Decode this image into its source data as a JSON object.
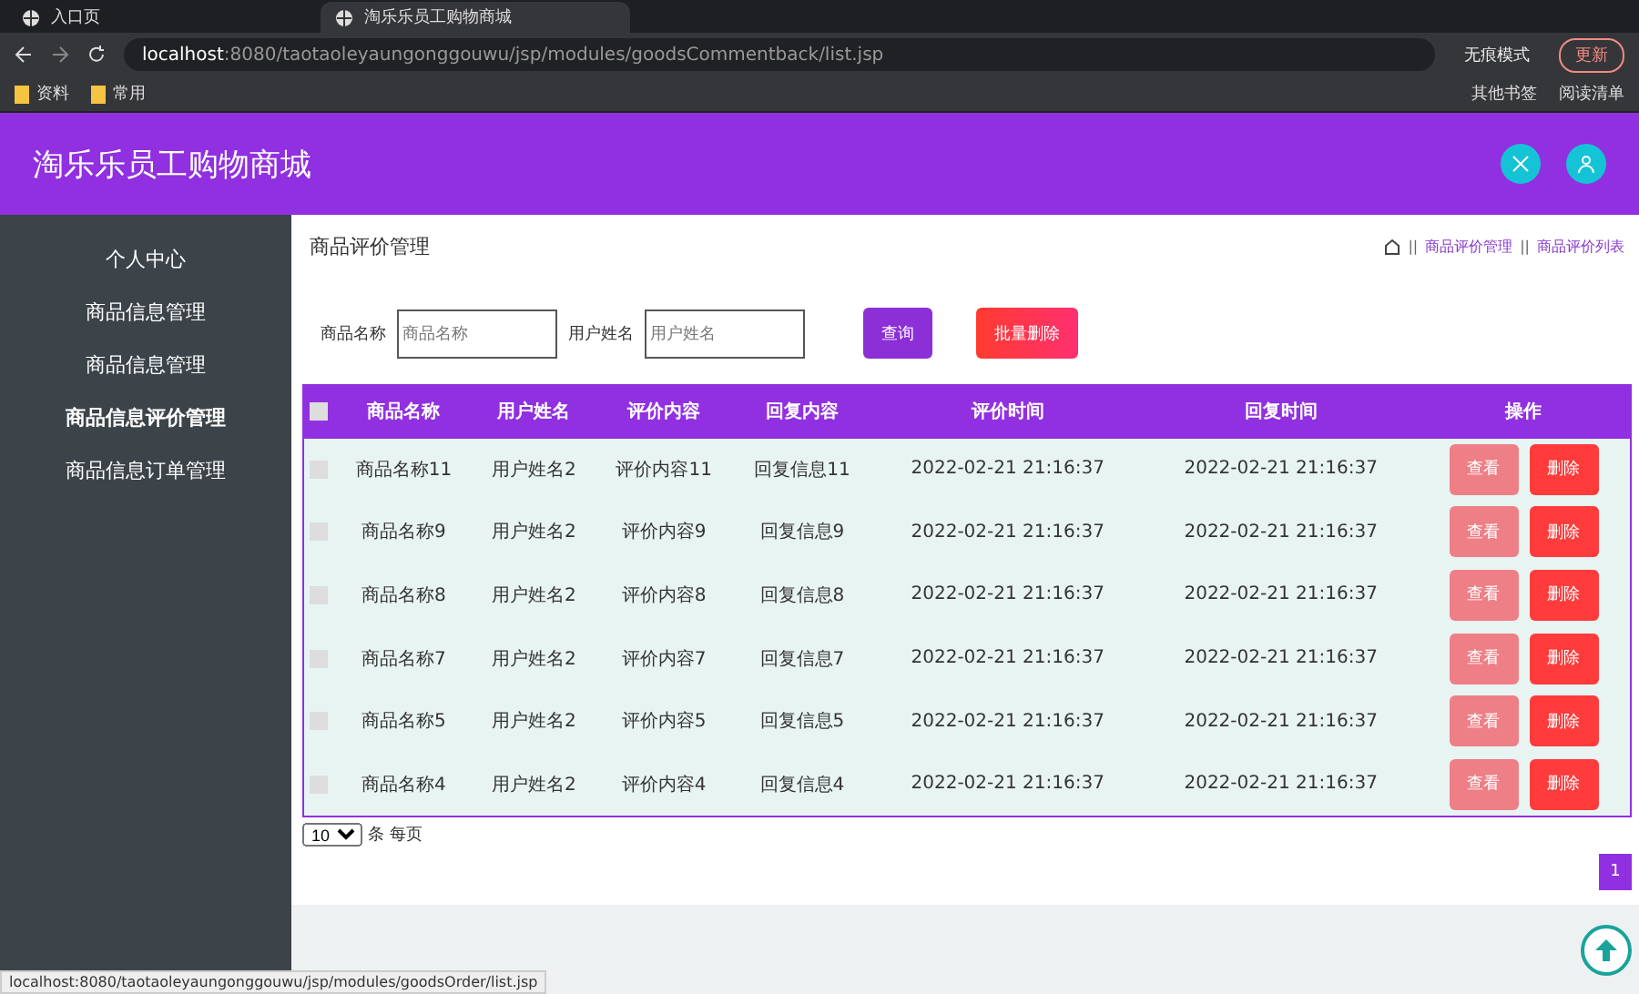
{
  "browser": {
    "tabs": [
      {
        "title": "入口页",
        "selected": false
      },
      {
        "title": "淘乐乐员工购物商城",
        "selected": true
      }
    ],
    "url_host": "localhost",
    "url_rest": ":8080/taotaoleyaungonggouwu/jsp/modules/goodsCommentback/list.jsp",
    "incognito": "无痕模式",
    "update": "更新",
    "bookmarks": [
      "资料",
      "常用"
    ],
    "bookmarks_right": [
      "其他书签",
      "阅读清单"
    ]
  },
  "app": {
    "title": "淘乐乐员工购物商城"
  },
  "sidebar": {
    "items": [
      {
        "label": "个人中心",
        "selected": false
      },
      {
        "label": "商品信息管理",
        "selected": false
      },
      {
        "label": "商品信息管理",
        "selected": false
      },
      {
        "label": "商品信息评价管理",
        "selected": true
      },
      {
        "label": "商品信息订单管理",
        "selected": false
      }
    ]
  },
  "page": {
    "title": "商品评价管理",
    "breadcrumb": [
      {
        "separator": "||",
        "label": "商品评价管理"
      },
      {
        "separator": "||",
        "label": "商品评价列表"
      }
    ]
  },
  "search": {
    "fields": [
      {
        "label": "商品名称",
        "placeholder": "商品名称"
      },
      {
        "label": "用户姓名",
        "placeholder": "用户姓名"
      }
    ],
    "query": "查询",
    "batch_delete": "批量删除"
  },
  "table": {
    "select_all_checked": false,
    "columns": [
      "商品名称",
      "用户姓名",
      "评价内容",
      "回复内容",
      "评价时间",
      "回复时间",
      "操作"
    ],
    "rows": [
      {
        "cells": [
          "商品名称11",
          "用户姓名2",
          "评价内容11",
          "回复信息11",
          "2022-02-21 21:16:37",
          "2022-02-21 21:16:37"
        ],
        "checked": false,
        "view": "查看",
        "delete": "删除"
      },
      {
        "cells": [
          "商品名称9",
          "用户姓名2",
          "评价内容9",
          "回复信息9",
          "2022-02-21 21:16:37",
          "2022-02-21 21:16:37"
        ],
        "checked": false,
        "view": "查看",
        "delete": "删除"
      },
      {
        "cells": [
          "商品名称8",
          "用户姓名2",
          "评价内容8",
          "回复信息8",
          "2022-02-21 21:16:37",
          "2022-02-21 21:16:37"
        ],
        "checked": false,
        "view": "查看",
        "delete": "删除"
      },
      {
        "cells": [
          "商品名称7",
          "用户姓名2",
          "评价内容7",
          "回复信息7",
          "2022-02-21 21:16:37",
          "2022-02-21 21:16:37"
        ],
        "checked": false,
        "view": "查看",
        "delete": "删除"
      },
      {
        "cells": [
          "商品名称5",
          "用户姓名2",
          "评价内容5",
          "回复信息5",
          "2022-02-21 21:16:37",
          "2022-02-21 21:16:37"
        ],
        "checked": false,
        "view": "查看",
        "delete": "删除"
      },
      {
        "cells": [
          "商品名称4",
          "用户姓名2",
          "评价内容4",
          "回复信息4",
          "2022-02-21 21:16:37",
          "2022-02-21 21:16:37"
        ],
        "checked": false,
        "view": "查看",
        "delete": "删除"
      }
    ]
  },
  "pager": {
    "page_size": "10",
    "per_page": "条 每页",
    "pages": [
      {
        "label": "1",
        "selected": true
      }
    ]
  },
  "status_bar": "localhost:8080/taotaoleyaungonggouwu/jsp/modules/goodsOrder/list.jsp"
}
